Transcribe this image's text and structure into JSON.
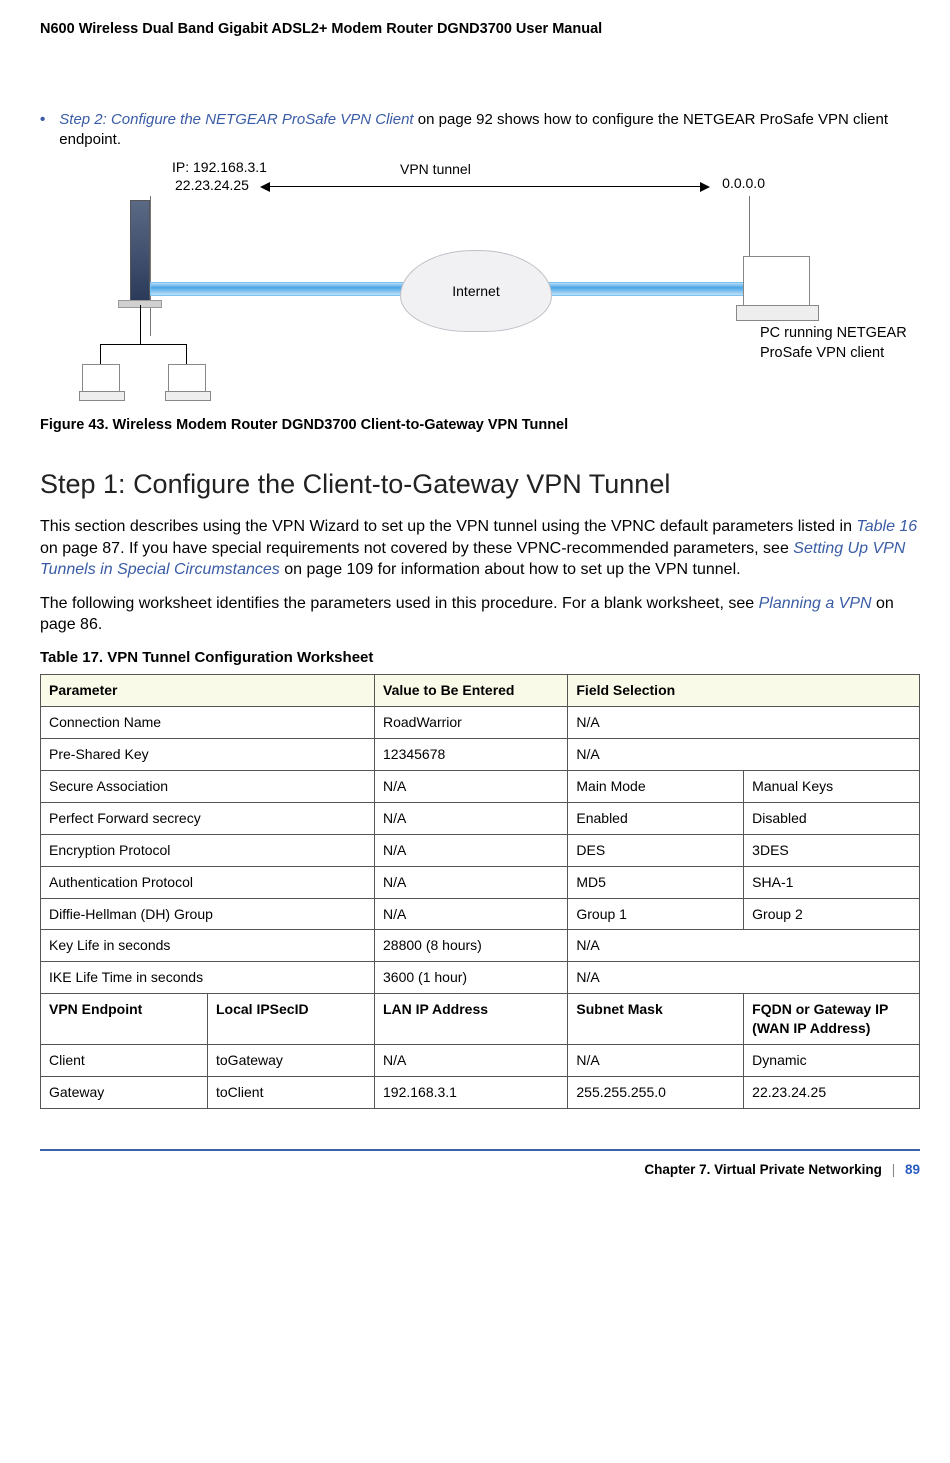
{
  "header": "N600 Wireless Dual Band Gigabit ADSL2+ Modem Router DGND3700 User Manual",
  "bullet": {
    "link": "Step 2: Configure the NETGEAR ProSafe VPN Client",
    "rest": " on page 92 shows how to configure the NETGEAR ProSafe VPN client endpoint."
  },
  "figure": {
    "ip_lan": "IP: 192.168.3.1",
    "ip_wan": "22.23.24.25",
    "vpn": "VPN tunnel",
    "ip_client": "0.0.0.0",
    "cloud": "Internet",
    "pc_caption": "PC running NETGEAR ProSafe VPN client",
    "caption": "Figure 43. Wireless Modem Router DGND3700 Client-to-Gateway VPN Tunnel"
  },
  "section": {
    "title": "Step 1: Configure the Client-to-Gateway VPN Tunnel",
    "p1_a": "This section describes using the VPN Wizard to set up the VPN tunnel using the VPNC default parameters listed in ",
    "p1_link1": "Table 16",
    "p1_b": " on page 87. If you have special requirements not covered by these VPNC-recommended parameters, see ",
    "p1_link2": "Setting Up VPN Tunnels in Special Circumstances",
    "p1_c": " on page 109 for information about how to set up the VPN tunnel.",
    "p2_a": "The following worksheet identifies the parameters used in this procedure. For a blank worksheet, see ",
    "p2_link": "Planning a VPN",
    "p2_b": " on page 86."
  },
  "table": {
    "caption": "Table 17.  VPN Tunnel Configuration Worksheet",
    "head": {
      "c1": "Parameter",
      "c2": "Value to Be Entered",
      "c3": "Field Selection"
    },
    "rows": [
      {
        "p": "Connection Name",
        "v": "RoadWarrior",
        "f1": "N/A",
        "span": true
      },
      {
        "p": "Pre-Shared Key",
        "v": "12345678",
        "f1": "N/A",
        "span": true
      },
      {
        "p": "Secure Association",
        "v": "N/A",
        "f1": "Main Mode",
        "f2": "Manual Keys"
      },
      {
        "p": "Perfect Forward secrecy",
        "v": "N/A",
        "f1": "Enabled",
        "f2": "Disabled"
      },
      {
        "p": "Encryption Protocol",
        "v": "N/A",
        "f1": "DES",
        "f2": "3DES"
      },
      {
        "p": "Authentication Protocol",
        "v": "N/A",
        "f1": "MD5",
        "f2": "SHA-1"
      },
      {
        "p": "Diffie-Hellman (DH) Group",
        "v": "N/A",
        "f1": "Group 1",
        "f2": "Group 2"
      },
      {
        "p": "Key Life in seconds",
        "v": "28800 (8 hours)",
        "f1": "N/A",
        "span": true
      },
      {
        "p": "IKE Life Time in seconds",
        "v": "3600 (1 hour)",
        "f1": "N/A",
        "span": true
      }
    ],
    "subhead": {
      "c1": "VPN Endpoint",
      "c2": "Local IPSecID",
      "c3": "LAN IP Address",
      "c4": "Subnet Mask",
      "c5": "FQDN or Gateway IP (WAN IP Address)"
    },
    "subrows": [
      {
        "c1": "Client",
        "c2": "toGateway",
        "c3": "N/A",
        "c4": "N/A",
        "c5": "Dynamic"
      },
      {
        "c1": "Gateway",
        "c2": "toClient",
        "c3": "192.168.3.1",
        "c4": "255.255.255.0",
        "c5": "22.23.24.25"
      }
    ]
  },
  "footer": {
    "chapter": "Chapter 7.  Virtual Private Networking",
    "page": "89"
  }
}
